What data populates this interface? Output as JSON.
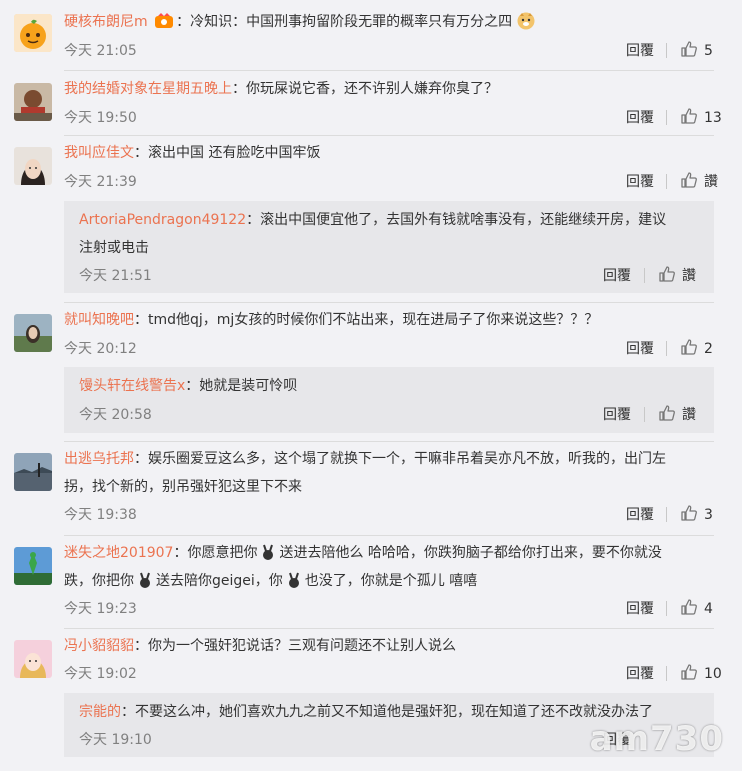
{
  "labels": {
    "reply": "回覆",
    "like_default": "讚"
  },
  "colors": {
    "username": "#eb7350",
    "background": "#f2f2f5",
    "reply_box": "#e7e7ea"
  },
  "comments": [
    {
      "user": "硬核布朗尼m",
      "text": "：冷知识：中国刑事拘留阶段无罪的概率只有万分之四",
      "time": "今天 21:05",
      "likes": "5"
    },
    {
      "user": "我的结婚对象在星期五晚上",
      "text": "：你玩屎说它香，还不许别人嫌弃你臭了？",
      "time": "今天 19:50",
      "likes": "13"
    },
    {
      "user": "我叫应佳文",
      "text": "：滚出中国 还有脸吃中国牢饭",
      "time": "今天 21:39",
      "likes": "讚",
      "reply": {
        "user": "ArtoriaPendragon49122",
        "text_line1": "：滚出中国便宜他了，去国外有钱就啥事没有，还能继续开房，建议",
        "text_line2": "注射或电击",
        "time": "今天 21:51",
        "likes": "讚"
      }
    },
    {
      "user": "就叫知晚吧",
      "text": "：tmd他qj，mj女孩的时候你们不站出来，现在进局子了你来说这些？？？",
      "time": "今天 20:12",
      "likes": "2",
      "reply": {
        "user": "馒头轩在线警告x",
        "text": "：她就是装可怜呗",
        "time": "今天 20:58",
        "likes": "讚"
      }
    },
    {
      "user": "出逃乌托邦",
      "text_line1": "：娱乐圈爱豆这么多，这个塌了就换下一个，干嘛非吊着吴亦凡不放，听我的，出门左",
      "text_line2": "拐，找个新的，别吊强奸犯这里下不来",
      "time": "今天 19:38",
      "likes": "3"
    },
    {
      "user": "迷失之地201907",
      "text_line1a": "：你愿意把你",
      "text_line1b": "送进去陪他么 哈哈哈，你跌狗脑子都给你打出来，要不你就没",
      "text_line2a": "跌，你把你",
      "text_line2b": "送去陪你geigei，你",
      "text_line2c": "也没了，你就是个孤儿 嘻嘻",
      "time": "今天 19:23",
      "likes": "4"
    },
    {
      "user": "冯小貂貂貂",
      "text": "：你为一个强奸犯说话？三观有问题还不让别人说么",
      "time": "今天 19:02",
      "likes": "10",
      "reply": {
        "user": "宗能的",
        "text": "：不要这么冲，她们喜欢九九之前又不知道他是强奸犯，现在知道了还不改就没办法了",
        "time": "今天 19:10"
      }
    }
  ],
  "watermark": "am730"
}
